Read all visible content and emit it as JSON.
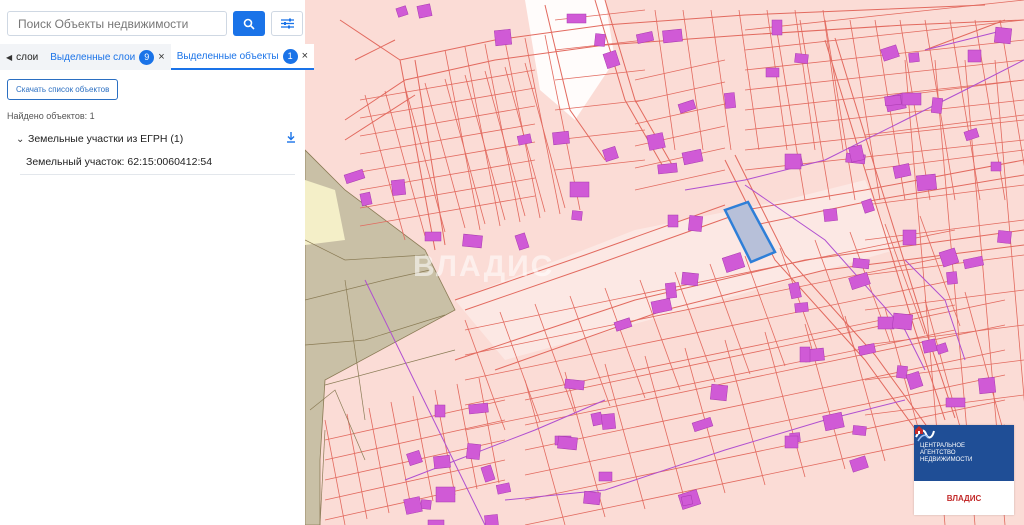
{
  "search": {
    "placeholder": "Поиск Объекты недвижимости"
  },
  "tabs": {
    "layers_label": "слои",
    "selected_layers_label": "Выделенные слои",
    "selected_layers_count": "9",
    "selected_objects_label": "Выделенные объекты",
    "selected_objects_count": "1",
    "close_glyph": "×"
  },
  "panel": {
    "export_label": "Скачать список объектов",
    "found_text": "Найдено объектов: 1",
    "group_title": "Земельные участки из ЕГРН (1)",
    "result_item": "Земельный участок: 62:15:0060412:54"
  },
  "map": {
    "watermark": "ВЛАДИС",
    "logo_line1": "ЦЕНТРАЛЬНОЕ",
    "logo_line2": "АГЕНТСТВО",
    "logo_line3": "НЕДВИЖИМОСТИ",
    "logo_brand": "ВЛАДИС"
  },
  "colors": {
    "accent": "#1a73e8",
    "parcel_fill": "#fbdcd6",
    "parcel_line": "#e0695f",
    "building": "#d05ad6",
    "selected": "#2e7fd8"
  }
}
